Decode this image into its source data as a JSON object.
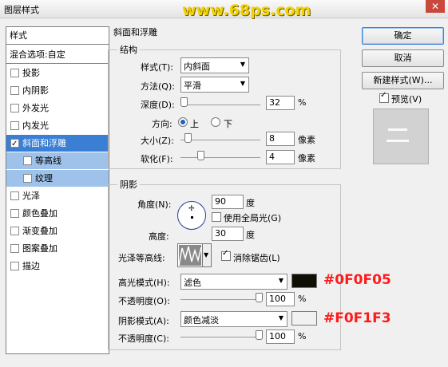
{
  "window": {
    "title": "图层样式",
    "close_glyph": "✕",
    "watermark": "www.68ps.com"
  },
  "sidebar": {
    "header": "样式",
    "blend": "混合选项:自定",
    "items": [
      {
        "label": "投影",
        "checked": false
      },
      {
        "label": "内阴影",
        "checked": false
      },
      {
        "label": "外发光",
        "checked": false
      },
      {
        "label": "内发光",
        "checked": false
      },
      {
        "label": "斜面和浮雕",
        "checked": true,
        "selected": true
      },
      {
        "label": "等高线",
        "checked": false,
        "sub": true
      },
      {
        "label": "纹理",
        "checked": false,
        "sub": true
      },
      {
        "label": "光泽",
        "checked": false
      },
      {
        "label": "颜色叠加",
        "checked": false
      },
      {
        "label": "渐变叠加",
        "checked": false
      },
      {
        "label": "图案叠加",
        "checked": false
      },
      {
        "label": "描边",
        "checked": false
      }
    ]
  },
  "bevel": {
    "group_title": "斜面和浮雕",
    "structure": {
      "title": "结构",
      "style_label": "样式(T):",
      "style_value": "内斜面",
      "method_label": "方法(Q):",
      "method_value": "平滑",
      "depth_label": "深度(D):",
      "depth_value": "32",
      "depth_unit": "%",
      "direction_label": "方向:",
      "dir_up": "上",
      "dir_down": "下",
      "size_label": "大小(Z):",
      "size_value": "8",
      "size_unit": "像素",
      "soften_label": "软化(F):",
      "soften_value": "4",
      "soften_unit": "像素"
    },
    "shading": {
      "title": "阴影",
      "angle_label": "角度(N):",
      "angle_value": "90",
      "angle_unit": "度",
      "global_light": "使用全局光(G)",
      "altitude_label": "高度:",
      "altitude_value": "30",
      "altitude_unit": "度",
      "gloss_label": "光泽等高线:",
      "antialias": "消除锯齿(L)",
      "highlight_label": "高光模式(H):",
      "highlight_value": "滤色",
      "highlight_color": "#0F0F05",
      "hl_opacity_label": "不透明度(O):",
      "hl_opacity_value": "100",
      "hl_opacity_unit": "%",
      "shadow_label": "阴影模式(A):",
      "shadow_value": "颜色减淡",
      "shadow_color": "#F0F1F3",
      "sh_opacity_label": "不透明度(C):",
      "sh_opacity_value": "100",
      "sh_opacity_unit": "%"
    }
  },
  "annotations": {
    "highlight_hex": "#0F0F05",
    "shadow_hex": "#F0F1F3"
  },
  "buttons": {
    "ok": "确定",
    "cancel": "取消",
    "new_style": "新建样式(W)...",
    "preview": "预览(V)"
  },
  "colors": {
    "accent": "#3a7fd4",
    "sub_highlight": "#9ec2ea",
    "annotation": "#ff1a1a",
    "watermark": "#f2d200"
  }
}
